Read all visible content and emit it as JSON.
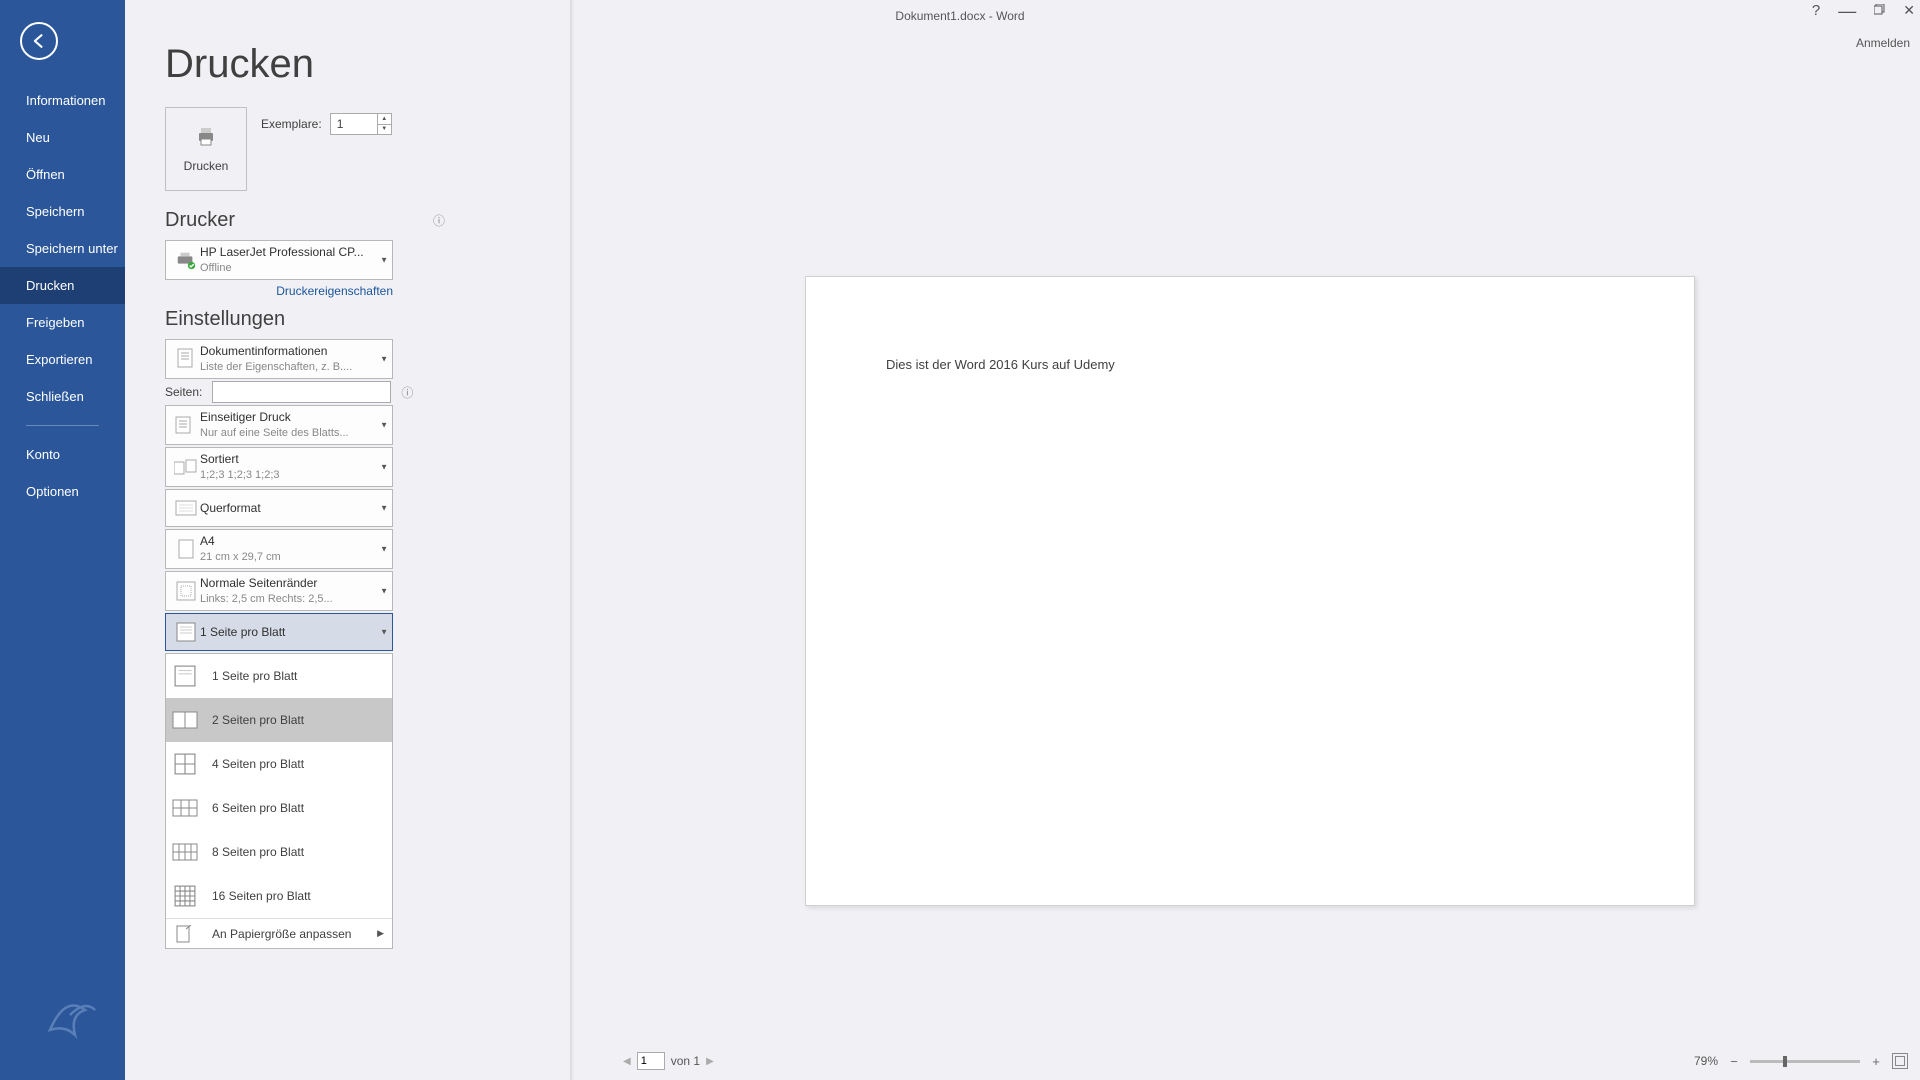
{
  "title": "Dokument1.docx - Word",
  "signin": "Anmelden",
  "sidebar": {
    "items": [
      {
        "label": "Informationen"
      },
      {
        "label": "Neu"
      },
      {
        "label": "Öffnen"
      },
      {
        "label": "Speichern"
      },
      {
        "label": "Speichern unter"
      },
      {
        "label": "Drucken"
      },
      {
        "label": "Freigeben"
      },
      {
        "label": "Exportieren"
      },
      {
        "label": "Schließen"
      }
    ],
    "footer": [
      {
        "label": "Konto"
      },
      {
        "label": "Optionen"
      }
    ]
  },
  "panel": {
    "title": "Drucken",
    "print_button_label": "Drucken",
    "copies_label": "Exemplare:",
    "copies_value": "1",
    "printer_heading": "Drucker",
    "printer": {
      "name": "HP LaserJet Professional CP...",
      "status": "Offline"
    },
    "printer_properties": "Druckereigenschaften",
    "settings_heading": "Einstellungen",
    "settings": {
      "what": {
        "primary": "Dokumentinformationen",
        "secondary": "Liste der Eigenschaften, z. B...."
      },
      "pages_label": "Seiten:",
      "sides": {
        "primary": "Einseitiger Druck",
        "secondary": "Nur auf eine Seite des Blatts..."
      },
      "collate": {
        "primary": "Sortiert",
        "secondary": "1;2;3    1;2;3    1;2;3"
      },
      "orientation": {
        "primary": "Querformat"
      },
      "paper": {
        "primary": "A4",
        "secondary": "21  cm x 29,7  cm"
      },
      "margins": {
        "primary": "Normale Seitenränder",
        "secondary": "Links: 2,5  cm    Rechts: 2,5..."
      },
      "pps": {
        "primary": "1 Seite pro Blatt"
      }
    },
    "pps_options": [
      "1 Seite pro Blatt",
      "2 Seiten pro Blatt",
      "4 Seiten pro Blatt",
      "6 Seiten pro Blatt",
      "8 Seiten pro Blatt",
      "16 Seiten pro Blatt"
    ],
    "pps_scale": "An Papiergröße anpassen"
  },
  "preview": {
    "text": "Dies ist der Word 2016 Kurs auf Udemy"
  },
  "status": {
    "current_page": "1",
    "of_label": "von 1",
    "zoom": "79%"
  }
}
